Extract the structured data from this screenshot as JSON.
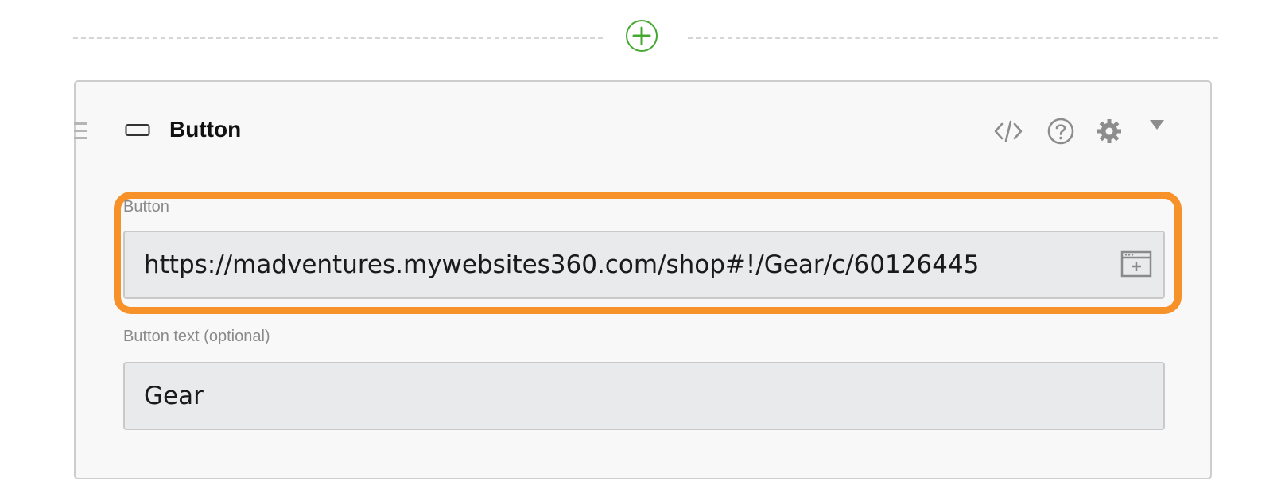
{
  "divider": {
    "add_button_icon": "plus-circle-icon",
    "accent_color": "#44a72f"
  },
  "block": {
    "title": "Button",
    "icons": {
      "drag": "drag-handle-icon",
      "type": "button-shape-icon",
      "code": "code-icon",
      "help": "help-icon",
      "settings": "gear-icon",
      "collapse": "caret-down-icon"
    },
    "fields": {
      "url": {
        "label": "Button",
        "value": "https://madventures.mywebsites360.com/shop#!/Gear/c/60126445",
        "picker_icon": "browse-link-icon"
      },
      "text": {
        "label": "Button text (optional)",
        "value": "Gear"
      }
    }
  },
  "highlight_color": "#f7922a"
}
